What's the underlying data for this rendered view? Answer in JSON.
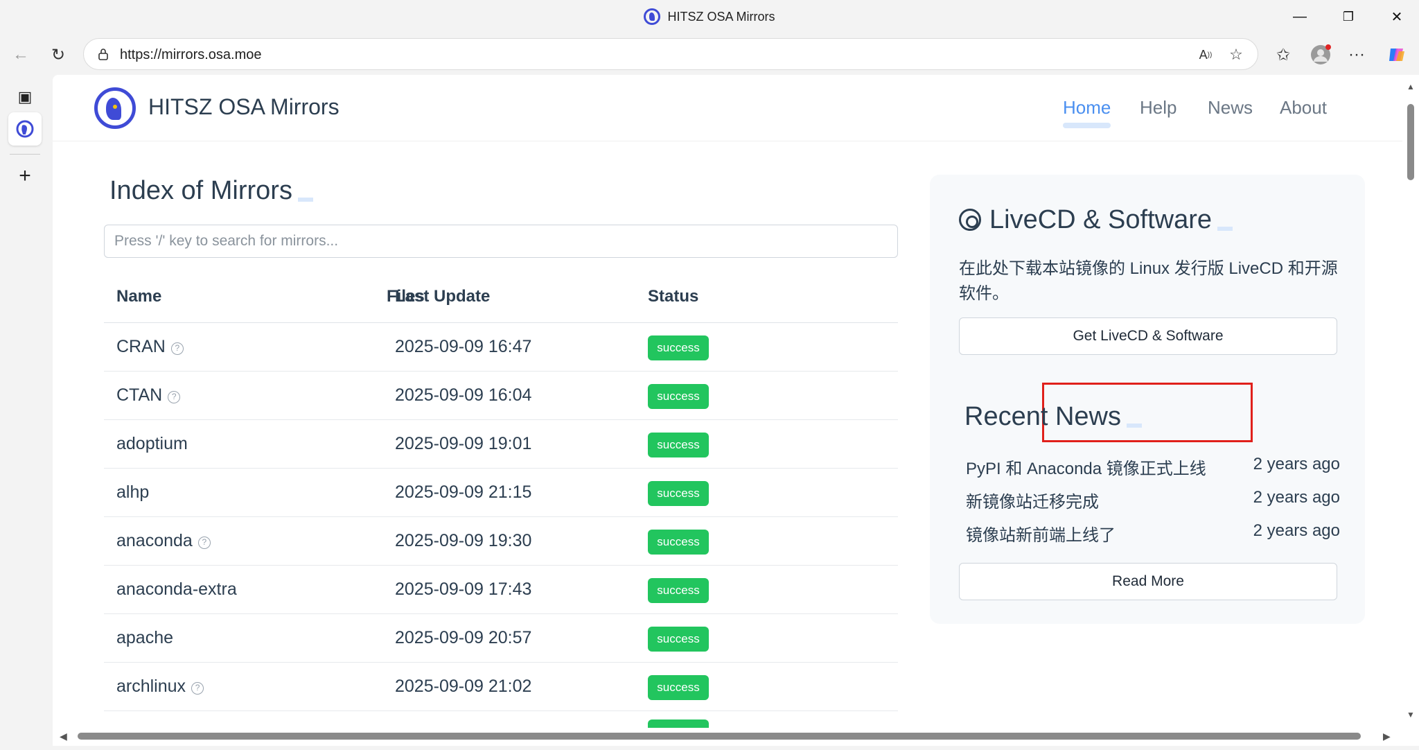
{
  "window": {
    "title": "HITSZ OSA Mirrors",
    "minimize": "—",
    "restore": "❐",
    "close": "✕"
  },
  "browser": {
    "url": "https://mirrors.osa.moe",
    "icons": [
      "back-icon",
      "refresh-icon",
      "lock-icon",
      "read-aloud-icon",
      "favorite-star-icon",
      "favorites-icon",
      "profile-avatar",
      "more-icon",
      "copilot-icon"
    ],
    "sidebar_icons": [
      "tab-actions-icon",
      "site-tab-icon",
      "new-tab-icon"
    ]
  },
  "site": {
    "brand": "HITSZ OSA Mirrors",
    "nav": {
      "home": "Home",
      "help": "Help",
      "news": "News",
      "about": "About"
    },
    "accent": "#4a8ff0",
    "success_color": "#22c55e"
  },
  "mirrors": {
    "title": "Index of Mirrors",
    "search_placeholder": "Press '/' key to search for mirrors...",
    "columns": {
      "name": "Name",
      "files": "Files",
      "last_update": "Last Update",
      "status": "Status"
    },
    "rows": [
      {
        "name": "CRAN",
        "help": true,
        "last_update": "2025-09-09 16:47",
        "status": "success"
      },
      {
        "name": "CTAN",
        "help": true,
        "last_update": "2025-09-09 16:04",
        "status": "success"
      },
      {
        "name": "adoptium",
        "help": false,
        "last_update": "2025-09-09 19:01",
        "status": "success"
      },
      {
        "name": "alhp",
        "help": false,
        "last_update": "2025-09-09 21:15",
        "status": "success"
      },
      {
        "name": "anaconda",
        "help": true,
        "last_update": "2025-09-09 19:30",
        "status": "success"
      },
      {
        "name": "anaconda-extra",
        "help": false,
        "last_update": "2025-09-09 17:43",
        "status": "success"
      },
      {
        "name": "apache",
        "help": false,
        "last_update": "2025-09-09 20:57",
        "status": "success"
      },
      {
        "name": "archlinux",
        "help": true,
        "last_update": "2025-09-09 21:02",
        "status": "success"
      }
    ]
  },
  "livecd": {
    "title": "LiveCD & Software",
    "description": "在此处下载本站镜像的 Linux 发行版 LiveCD 和开源软件。",
    "button": "Get LiveCD & Software",
    "highlight_color": "#e0201b"
  },
  "news": {
    "title": "Recent News",
    "items": [
      {
        "title": "PyPI 和 Anaconda 镜像正式上线",
        "ago": "2 years ago"
      },
      {
        "title": "新镜像站迁移完成",
        "ago": "2 years ago"
      },
      {
        "title": "镜像站新前端上线了",
        "ago": "2 years ago"
      }
    ],
    "read_more": "Read More"
  }
}
